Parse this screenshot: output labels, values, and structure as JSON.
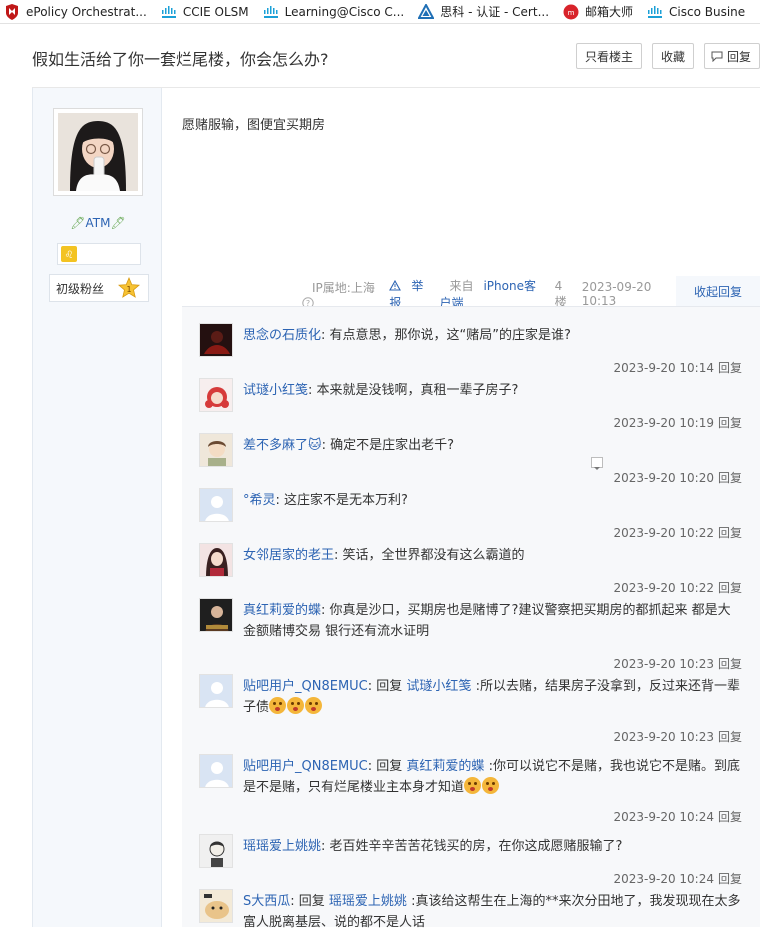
{
  "bookmarks": [
    {
      "label": "ePolicy Orchestrat...",
      "icon": "mcafee-shield-icon",
      "color": "#c01818"
    },
    {
      "label": "CCIE OLSM",
      "icon": "cisco-logo-icon",
      "color": "#1ba0d7"
    },
    {
      "label": "Learning@Cisco C...",
      "icon": "cisco-logo-icon",
      "color": "#1ba0d7"
    },
    {
      "label": "思科 - 认证 - Cert...",
      "icon": "triangle-logo-icon",
      "color": "#1f6fb5"
    },
    {
      "label": "邮箱大师",
      "icon": "netease-mail-icon",
      "color": "#d8232a"
    },
    {
      "label": "Cisco Busine",
      "icon": "cisco-logo-icon",
      "color": "#1ba0d7"
    }
  ],
  "thread": {
    "title": "假如生活给了你一套烂尾楼，你会怎么办?",
    "only_op": "只看楼主",
    "favorite": "收藏",
    "reply": "回复"
  },
  "post": {
    "username": "ATM",
    "fan_level": "初级粉丝",
    "fan_level_num": "1",
    "content": "愿赌服输，图便宜买期房",
    "meta": {
      "ip": "IP属地:上海",
      "report": "举报",
      "client_prefix": "来自",
      "client": "iPhone客户端",
      "floor": "4楼",
      "time": "2023-09-20 10:13"
    },
    "fold": "收起回复"
  },
  "replies": [
    {
      "user": "思念の石质化",
      "sep": ":",
      "text": " 有点意思，那你说，这“赌局”的庄家是谁?",
      "time": "2023-9-20 10:14",
      "action": "回复",
      "avatar": "#3a1a1a"
    },
    {
      "user": "试璲小红笺",
      "sep": ":",
      "text": " 本来就是没钱啊，真租一辈子房子?",
      "time": "2023-9-20 10:19",
      "action": "回复",
      "avatar": "#f2e6e6"
    },
    {
      "user": "差不多麻了🐱",
      "sep": ":",
      "text": " 确定不是庄家出老千?",
      "time": "2023-9-20 10:20",
      "action": "回复",
      "avatar": "#e6dccb"
    },
    {
      "user": "°希灵",
      "sep": ":",
      "text": " 这庄家不是无本万利?",
      "time": "2023-9-20 10:22",
      "action": "回复",
      "avatar": "#dbe6f5"
    },
    {
      "user": "女邻居家的老王",
      "sep": ":",
      "text": " 笑话，全世界都没有这么霸道的",
      "time": "2023-9-20 10:22",
      "action": "回复",
      "avatar": "#e8c9c9"
    },
    {
      "user": "真红莉爱的蝶",
      "sep": ":",
      "text": " 你真是沙口，买期房也是赌博了?建议警察把买期房的都抓起来 都是大金额赌博交易 银行还有流水证明",
      "time": "2023-9-20 10:23",
      "action": "回复",
      "avatar": "#2b2b2b"
    },
    {
      "user": "贴吧用户_QN8EMUC",
      "sep": ":",
      "prefix": " 回复 ",
      "reply_to": "试璲小红笺",
      "text": " :所以去赌，结果房子没拿到，反过来还背一辈子债",
      "emoji_count": "3",
      "time": "2023-9-20 10:23",
      "action": "回复",
      "avatar": "#dbe6f5"
    },
    {
      "user": "贴吧用户_QN8EMUC",
      "sep": ":",
      "prefix": " 回复 ",
      "reply_to": "真红莉爱的蝶",
      "text": " :你可以说它不是赌，我也说它不是赌。到底是不是赌，只有烂尾楼业主本身才知道",
      "emoji_count": "2",
      "time": "2023-9-20 10:24",
      "action": "回复",
      "avatar": "#dbe6f5"
    },
    {
      "user": "瑶瑶爱上姚姚",
      "sep": ":",
      "text": " 老百姓辛辛苦苦花钱买的房，在你这成愿赌服输了?",
      "time": "2023-9-20 10:24",
      "action": "回复",
      "avatar": "#ececec"
    },
    {
      "user": "S大西瓜",
      "sep": ":",
      "prefix": " 回复 ",
      "reply_to": "瑶瑶爱上姚姚",
      "text": " :真该给这帮生在上海的**来次分田地了，我发现现在太多富人脱离基层、说的都不是人话",
      "time": "",
      "action": "",
      "avatar": "#efe3cf"
    }
  ]
}
